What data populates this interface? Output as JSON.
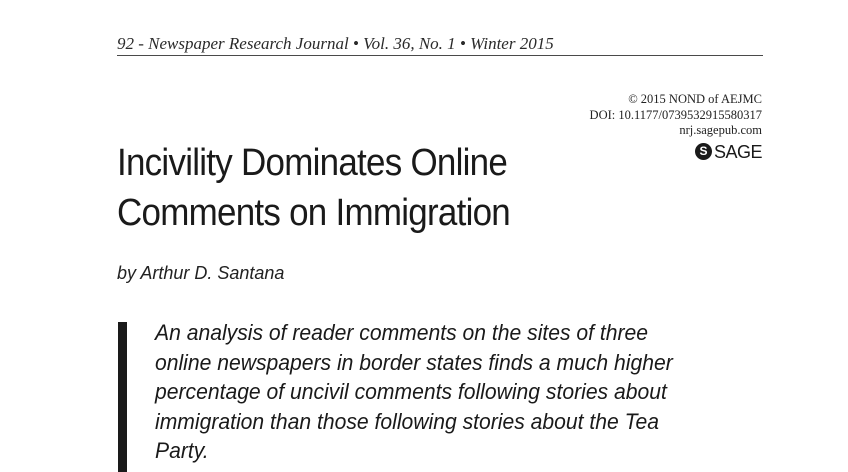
{
  "running_header": "92 - Newspaper Research Journal • Vol. 36, No. 1 • Winter 2015",
  "publisher_meta": {
    "copyright": "© 2015 NOND of AEJMC",
    "doi": "DOI: 10.1177/0739532915580317",
    "url": "nrj.sagepub.com",
    "logo_text": "SAGE"
  },
  "article": {
    "title_lines": [
      "Incivility Dominates Online",
      "Comments on Immigration"
    ],
    "byline": "by Arthur D. Santana",
    "abstract_lines": [
      "An analysis of reader comments on the sites of three",
      "online newspapers in border states finds a much higher",
      "percentage of uncivil comments following stories about",
      "immigration than those following stories about the Tea",
      "Party."
    ]
  }
}
